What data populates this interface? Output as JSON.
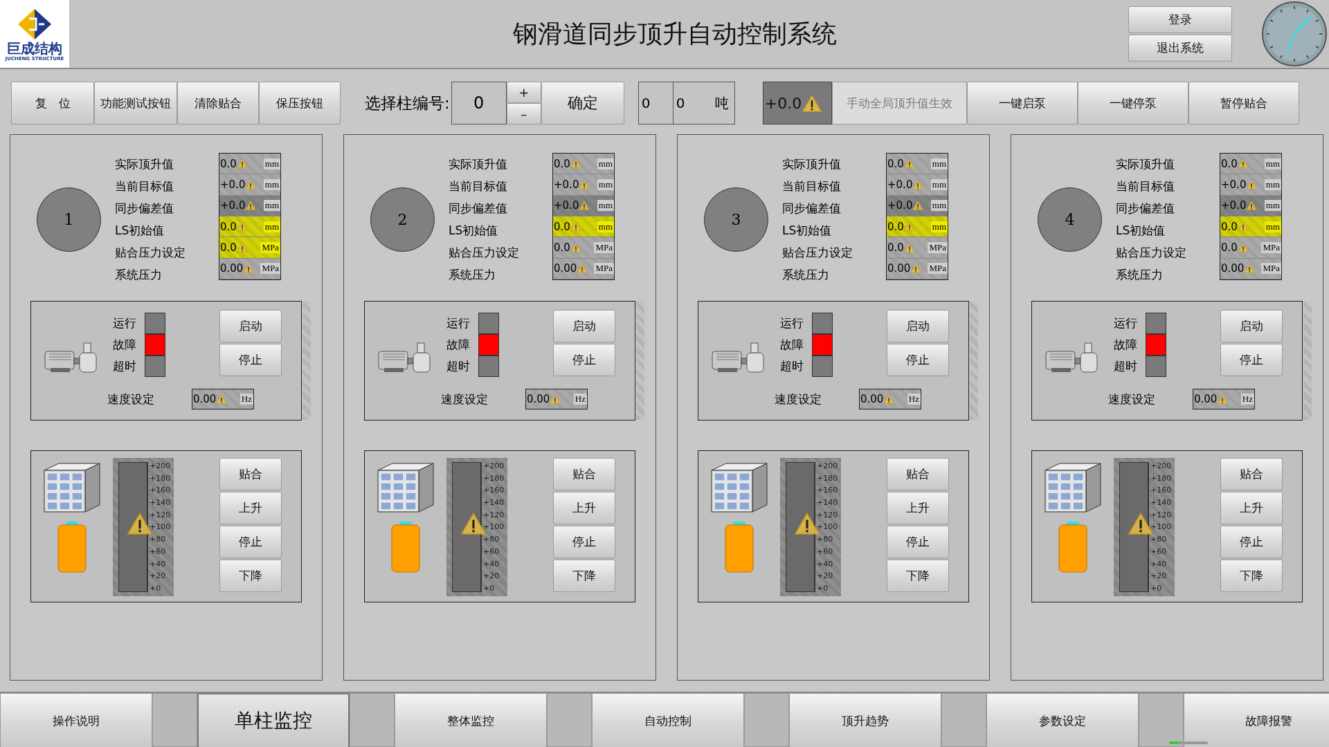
{
  "logo": {
    "name": "巨成结构",
    "subtitle": "JUCHENG STRUCTURE"
  },
  "title": "钢滑道同步顶升自动控制系统",
  "account_buttons": [
    "登录",
    "退出系统"
  ],
  "toolbar": {
    "left_buttons": [
      "复　位",
      "功能测试按钮",
      "清除贴合",
      "保压按钮"
    ],
    "column_select": {
      "label": "选择柱编号:",
      "value": "0",
      "increment": "+",
      "decrement": "–",
      "confirm": "确定"
    },
    "load": {
      "value_1": "0",
      "value_2": "0",
      "unit": "吨"
    },
    "global_value": "+0.0",
    "right_buttons": [
      {
        "label": "手动全局顶升值生效",
        "disabled": true
      },
      {
        "label": "一键启泵",
        "disabled": false
      },
      {
        "label": "一键停泵",
        "disabled": false
      },
      {
        "label": "暂停贴合",
        "disabled": false
      }
    ]
  },
  "panels": [
    {
      "number": "1",
      "readings": [
        {
          "label": "实际顶升值",
          "value": "0.0",
          "unit": "mm",
          "highlighted": false,
          "shaded": false
        },
        {
          "label": "当前目标值",
          "value": "+0.0",
          "unit": "mm",
          "highlighted": false,
          "shaded": false
        },
        {
          "label": "同步偏差值",
          "value": "+0.0",
          "unit": "mm",
          "highlighted": false,
          "shaded": true
        },
        {
          "label": "LS初始值",
          "value": "0.0",
          "unit": "mm",
          "highlighted": true,
          "shaded": false
        },
        {
          "label": "贴合压力设定",
          "value": "0.0",
          "unit": "MPa",
          "highlighted": true,
          "shaded": false
        },
        {
          "label": "系统压力",
          "value": "0.00",
          "unit": "MPa",
          "highlighted": false,
          "shaded": false
        }
      ],
      "lamps": [
        {
          "label": "运行",
          "on": false
        },
        {
          "label": "故障",
          "on": true
        },
        {
          "label": "超时",
          "on": false
        }
      ],
      "pump_buttons": [
        "启动",
        "停止"
      ],
      "speed": {
        "label": "速度设定",
        "value": "0.00",
        "unit": "Hz"
      },
      "scale": [
        "+200",
        "+180",
        "+160",
        "+140",
        "+120",
        "+100",
        "+80",
        "+60",
        "+40",
        "+20",
        "+0"
      ],
      "lift_buttons": [
        "贴合",
        "上升",
        "停止",
        "下降"
      ]
    },
    {
      "number": "2",
      "readings": [
        {
          "label": "实际顶升值",
          "value": "0.0",
          "unit": "mm",
          "highlighted": false,
          "shaded": false
        },
        {
          "label": "当前目标值",
          "value": "+0.0",
          "unit": "mm",
          "highlighted": false,
          "shaded": false
        },
        {
          "label": "同步偏差值",
          "value": "+0.0",
          "unit": "mm",
          "highlighted": false,
          "shaded": true
        },
        {
          "label": "LS初始值",
          "value": "0.0",
          "unit": "mm",
          "highlighted": true,
          "shaded": false
        },
        {
          "label": "贴合压力设定",
          "value": "0.0",
          "unit": "MPa",
          "highlighted": false,
          "shaded": false
        },
        {
          "label": "系统压力",
          "value": "0.00",
          "unit": "MPa",
          "highlighted": false,
          "shaded": false
        }
      ],
      "lamps": [
        {
          "label": "运行",
          "on": false
        },
        {
          "label": "故障",
          "on": true
        },
        {
          "label": "超时",
          "on": false
        }
      ],
      "pump_buttons": [
        "启动",
        "停止"
      ],
      "speed": {
        "label": "速度设定",
        "value": "0.00",
        "unit": "Hz"
      },
      "scale": [
        "+200",
        "+180",
        "+160",
        "+140",
        "+120",
        "+100",
        "+80",
        "+60",
        "+40",
        "+20",
        "+0"
      ],
      "lift_buttons": [
        "贴合",
        "上升",
        "停止",
        "下降"
      ]
    },
    {
      "number": "3",
      "readings": [
        {
          "label": "实际顶升值",
          "value": "0.0",
          "unit": "mm",
          "highlighted": false,
          "shaded": false
        },
        {
          "label": "当前目标值",
          "value": "+0.0",
          "unit": "mm",
          "highlighted": false,
          "shaded": false
        },
        {
          "label": "同步偏差值",
          "value": "+0.0",
          "unit": "mm",
          "highlighted": false,
          "shaded": true
        },
        {
          "label": "LS初始值",
          "value": "0.0",
          "unit": "mm",
          "highlighted": true,
          "shaded": false
        },
        {
          "label": "贴合压力设定",
          "value": "0.0",
          "unit": "MPa",
          "highlighted": false,
          "shaded": false
        },
        {
          "label": "系统压力",
          "value": "0.00",
          "unit": "MPa",
          "highlighted": false,
          "shaded": false
        }
      ],
      "lamps": [
        {
          "label": "运行",
          "on": false
        },
        {
          "label": "故障",
          "on": true
        },
        {
          "label": "超时",
          "on": false
        }
      ],
      "pump_buttons": [
        "启动",
        "停止"
      ],
      "speed": {
        "label": "速度设定",
        "value": "0.00",
        "unit": "Hz"
      },
      "scale": [
        "+200",
        "+180",
        "+160",
        "+140",
        "+120",
        "+100",
        "+80",
        "+60",
        "+40",
        "+20",
        "+0"
      ],
      "lift_buttons": [
        "贴合",
        "上升",
        "停止",
        "下降"
      ]
    },
    {
      "number": "4",
      "readings": [
        {
          "label": "实际顶升值",
          "value": "0.0",
          "unit": "mm",
          "highlighted": false,
          "shaded": false
        },
        {
          "label": "当前目标值",
          "value": "+0.0",
          "unit": "mm",
          "highlighted": false,
          "shaded": false
        },
        {
          "label": "同步偏差值",
          "value": "+0.0",
          "unit": "mm",
          "highlighted": false,
          "shaded": true
        },
        {
          "label": "LS初始值",
          "value": "0.0",
          "unit": "mm",
          "highlighted": true,
          "shaded": false
        },
        {
          "label": "贴合压力设定",
          "value": "0.0",
          "unit": "MPa",
          "highlighted": false,
          "shaded": false
        },
        {
          "label": "系统压力",
          "value": "0.00",
          "unit": "MPa",
          "highlighted": false,
          "shaded": false
        }
      ],
      "lamps": [
        {
          "label": "运行",
          "on": false
        },
        {
          "label": "故障",
          "on": true
        },
        {
          "label": "超时",
          "on": false
        }
      ],
      "pump_buttons": [
        "启动",
        "停止"
      ],
      "speed": {
        "label": "速度设定",
        "value": "0.00",
        "unit": "Hz"
      },
      "scale": [
        "+200",
        "+180",
        "+160",
        "+140",
        "+120",
        "+100",
        "+80",
        "+60",
        "+40",
        "+20",
        "+0"
      ],
      "lift_buttons": [
        "贴合",
        "上升",
        "停止",
        "下降"
      ]
    }
  ],
  "nav": [
    {
      "label": "操作说明",
      "selected": false
    },
    {
      "label": "单柱监控",
      "selected": true
    },
    {
      "label": "整体监控",
      "selected": false
    },
    {
      "label": "自动控制",
      "selected": false
    },
    {
      "label": "顶升趋势",
      "selected": false
    },
    {
      "label": "参数设定",
      "selected": false
    },
    {
      "label": "故障报警",
      "selected": false
    }
  ]
}
